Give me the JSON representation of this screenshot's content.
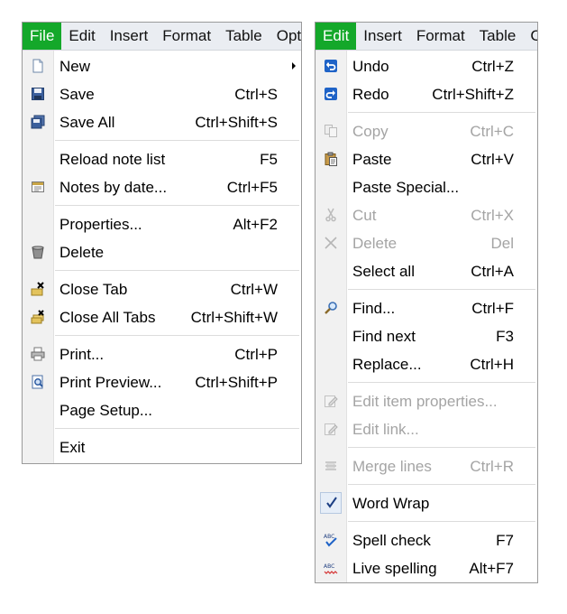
{
  "left_window": {
    "menubar": [
      "File",
      "Edit",
      "Insert",
      "Format",
      "Table",
      "Opt"
    ],
    "active_menu": "File",
    "items": {
      "new": {
        "label": "New",
        "shortcut": ""
      },
      "save": {
        "label": "Save",
        "shortcut": "Ctrl+S"
      },
      "save_all": {
        "label": "Save All",
        "shortcut": "Ctrl+Shift+S"
      },
      "reload": {
        "label": "Reload note list",
        "shortcut": "F5"
      },
      "notes_by_date": {
        "label": "Notes by date...",
        "shortcut": "Ctrl+F5"
      },
      "properties": {
        "label": "Properties...",
        "shortcut": "Alt+F2"
      },
      "delete": {
        "label": "Delete",
        "shortcut": ""
      },
      "close_tab": {
        "label": "Close Tab",
        "shortcut": "Ctrl+W"
      },
      "close_all_tabs": {
        "label": "Close All Tabs",
        "shortcut": "Ctrl+Shift+W"
      },
      "print": {
        "label": "Print...",
        "shortcut": "Ctrl+P"
      },
      "print_preview": {
        "label": "Print Preview...",
        "shortcut": "Ctrl+Shift+P"
      },
      "page_setup": {
        "label": "Page Setup...",
        "shortcut": ""
      },
      "exit": {
        "label": "Exit",
        "shortcut": ""
      }
    }
  },
  "right_window": {
    "menubar": [
      "Edit",
      "Insert",
      "Format",
      "Table",
      "C"
    ],
    "active_menu": "Edit",
    "items": {
      "undo": {
        "label": "Undo",
        "shortcut": "Ctrl+Z"
      },
      "redo": {
        "label": "Redo",
        "shortcut": "Ctrl+Shift+Z"
      },
      "copy": {
        "label": "Copy",
        "shortcut": "Ctrl+C"
      },
      "paste": {
        "label": "Paste",
        "shortcut": "Ctrl+V"
      },
      "paste_special": {
        "label": "Paste Special...",
        "shortcut": ""
      },
      "cut": {
        "label": "Cut",
        "shortcut": "Ctrl+X"
      },
      "delete": {
        "label": "Delete",
        "shortcut": "Del"
      },
      "select_all": {
        "label": "Select all",
        "shortcut": "Ctrl+A"
      },
      "find": {
        "label": "Find...",
        "shortcut": "Ctrl+F"
      },
      "find_next": {
        "label": "Find next",
        "shortcut": "F3"
      },
      "replace": {
        "label": "Replace...",
        "shortcut": "Ctrl+H"
      },
      "edit_item_props": {
        "label": "Edit item properties...",
        "shortcut": ""
      },
      "edit_link": {
        "label": "Edit link...",
        "shortcut": ""
      },
      "merge_lines": {
        "label": "Merge lines",
        "shortcut": "Ctrl+R"
      },
      "word_wrap": {
        "label": "Word Wrap",
        "shortcut": ""
      },
      "spell_check": {
        "label": "Spell check",
        "shortcut": "F7"
      },
      "live_spelling": {
        "label": "Live spelling",
        "shortcut": "Alt+F7"
      }
    }
  },
  "colors": {
    "active_menu_bg": "#14a82a",
    "disabled_text": "#a4a4a4"
  }
}
